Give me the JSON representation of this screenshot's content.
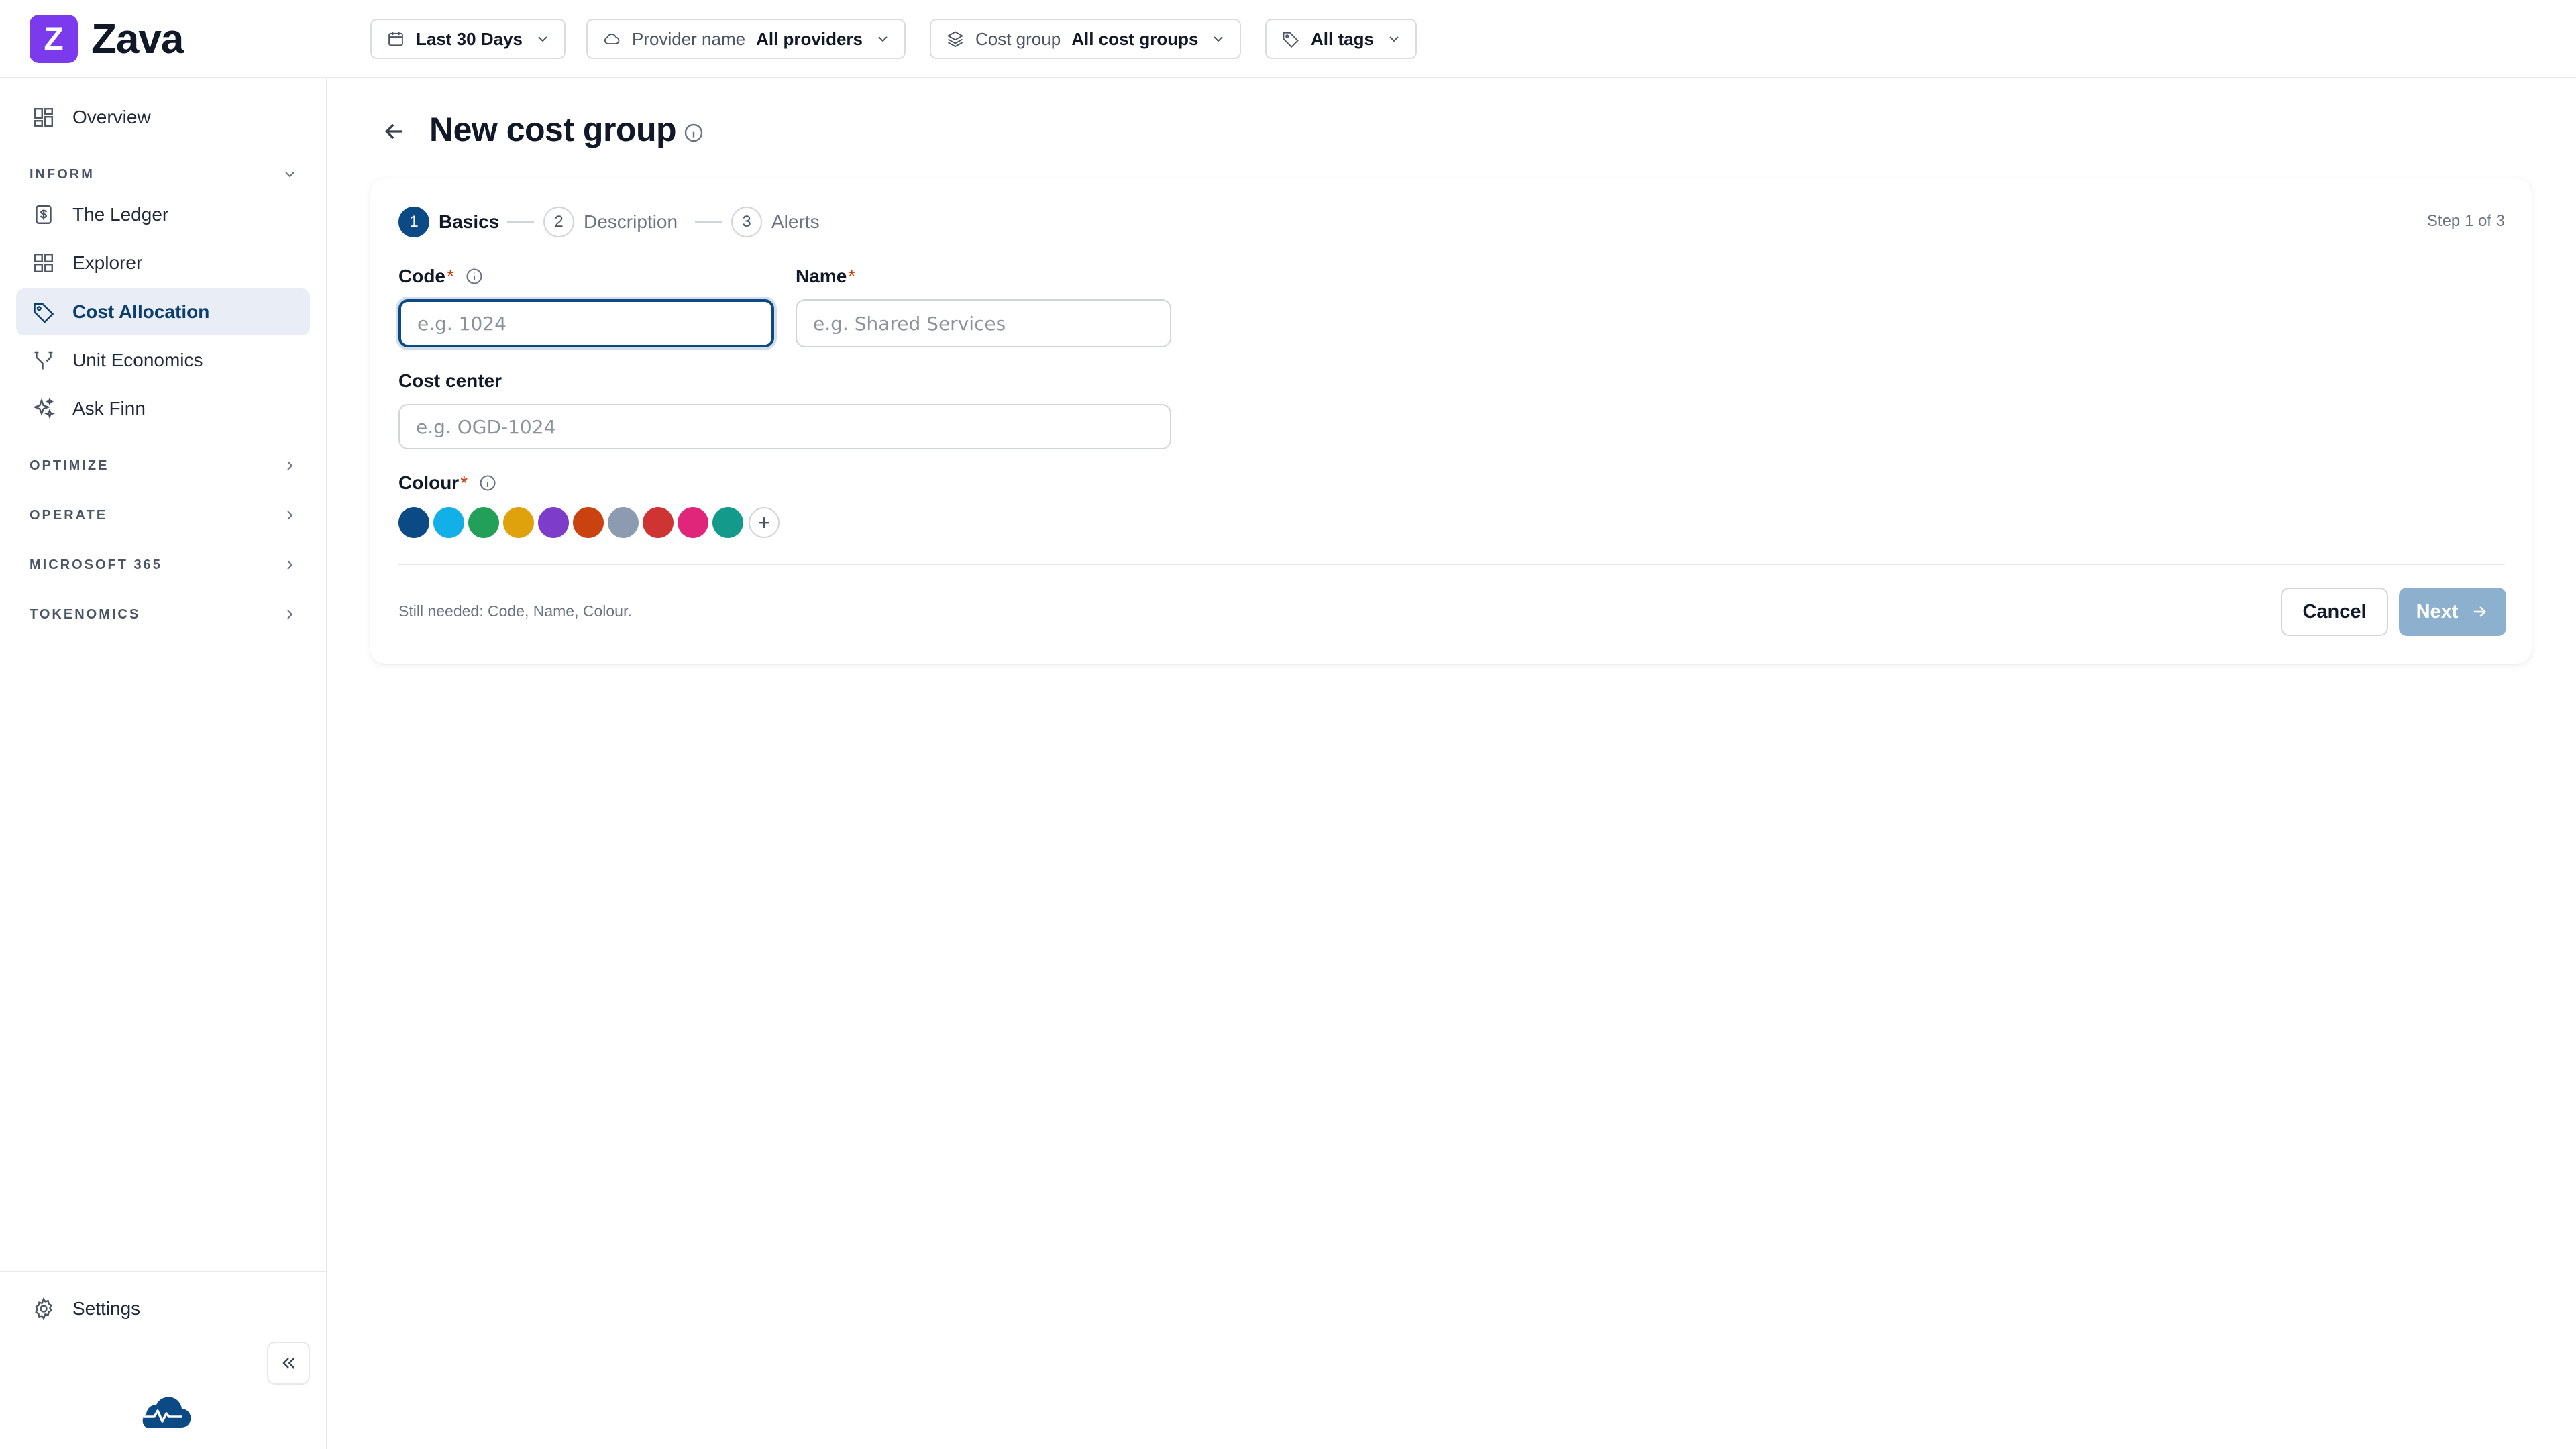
{
  "brand": {
    "logo_letter": "Z",
    "name": "Zava"
  },
  "filters": [
    {
      "icon": "calendar-icon",
      "key": "",
      "value": "Last 30 Days"
    },
    {
      "icon": "cloud-icon",
      "key": "Provider name",
      "value": "All providers"
    },
    {
      "icon": "layers-icon",
      "key": "Cost group",
      "value": "All cost groups"
    },
    {
      "icon": "tag-icon",
      "key": "",
      "value": "All tags"
    }
  ],
  "sidebar": {
    "overview": "Overview",
    "inform_label": "INFORM",
    "inform_items": [
      {
        "label": "The Ledger",
        "icon": "ledger-icon"
      },
      {
        "label": "Explorer",
        "icon": "grid-icon"
      },
      {
        "label": "Cost Allocation",
        "icon": "tag-icon",
        "active": true
      },
      {
        "label": "Unit Economics",
        "icon": "branch-icon"
      },
      {
        "label": "Ask Finn",
        "icon": "sparkle-icon"
      }
    ],
    "sections": [
      "OPTIMIZE",
      "OPERATE",
      "MICROSOFT 365",
      "TOKENOMICS"
    ],
    "settings": "Settings"
  },
  "page": {
    "title": "New cost group"
  },
  "wizard": {
    "steps": [
      {
        "num": "1",
        "label": "Basics"
      },
      {
        "num": "2",
        "label": "Description"
      },
      {
        "num": "3",
        "label": "Alerts"
      }
    ],
    "step_count": "Step 1 of 3"
  },
  "form": {
    "code_label": "Code",
    "code_placeholder": "e.g. 1024",
    "code_value": "",
    "name_label": "Name",
    "name_placeholder": "e.g. Shared Services",
    "name_value": "",
    "cost_center_label": "Cost center",
    "cost_center_placeholder": "e.g. OGD-1024",
    "cost_center_value": "",
    "colour_label": "Colour",
    "required_marker": "*",
    "colours": [
      "#0b4a85",
      "#12b0e6",
      "#22a05a",
      "#e0a20c",
      "#7d3cc9",
      "#c9420f",
      "#8d9bb0",
      "#cf3434",
      "#e0267a",
      "#149a8a"
    ],
    "add_colour": "+",
    "still_needed": "Still needed: Code, Name, Colour."
  },
  "actions": {
    "cancel": "Cancel",
    "next": "Next"
  },
  "theme": {
    "accent": "#0b4a85",
    "brand": "#7c3aed",
    "active_nav_bg": "#e9eef6"
  }
}
